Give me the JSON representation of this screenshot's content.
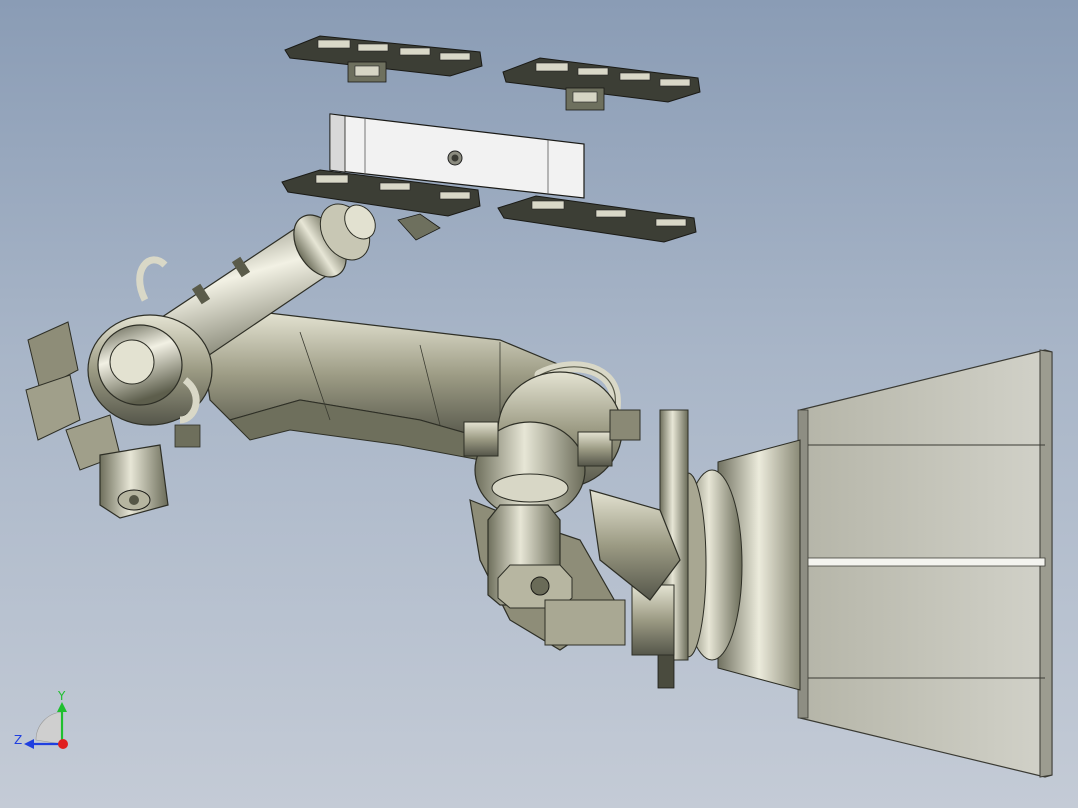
{
  "viewport": {
    "background_top": "#8a9cb5",
    "background_bottom": "#c4cbd6"
  },
  "triad": {
    "y_label": "Y",
    "z_label": "Z",
    "y_color": "#1fbf2f",
    "z_color": "#1f3fe0",
    "x_color": "#e01f1f"
  },
  "model": {
    "body_color": "#b9b8a2",
    "body_shade": "#5a5c48",
    "plate_color": "#3c3e35",
    "box_color": "#f2f2f2",
    "base_color": "#c8c8bd"
  }
}
